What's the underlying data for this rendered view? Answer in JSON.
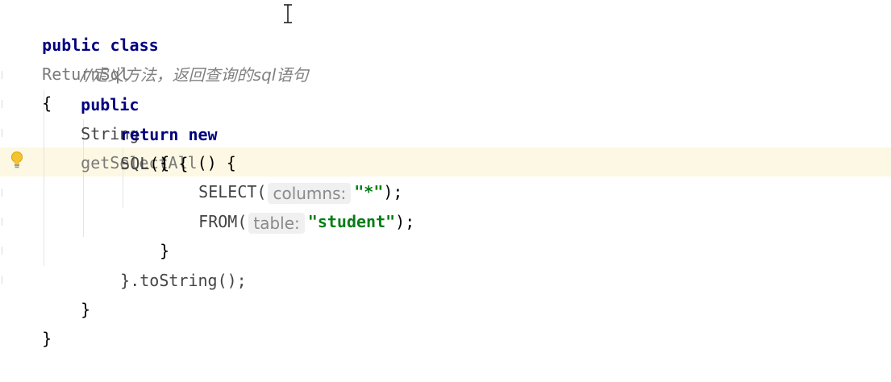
{
  "code": {
    "l1_kw": "public class",
    "l1_name": "ReturnSql",
    "l1_brace": "{",
    "l2_comment": "//定义方法，返回查询的sql语句",
    "l3_kw": "public",
    "l3_type": "String",
    "l3_method": "getSelectAll",
    "l3_rest": "() {",
    "l4_kw": "return new",
    "l4_class": "SQL",
    "l4_rest": "() {",
    "l5_brace": "{",
    "l6_call": "SELECT(",
    "l6_hint": "columns:",
    "l6_arg": "\"*\"",
    "l6_end": ");",
    "l7_call": "FROM(",
    "l7_hint": "table:",
    "l7_arg": "\"student\"",
    "l7_end": ");",
    "l8_brace": "}",
    "l9_text": "}.toString();",
    "l10_brace": "}",
    "l11_brace": "}"
  },
  "icons": {
    "intention": "lightbulb-icon",
    "cursor": "text-cursor-icon"
  },
  "colors": {
    "keyword": "#000080",
    "string": "#067d17",
    "comment": "#808080",
    "current_line": "#fdf8e3",
    "hint_bg": "#f0f0f0"
  }
}
